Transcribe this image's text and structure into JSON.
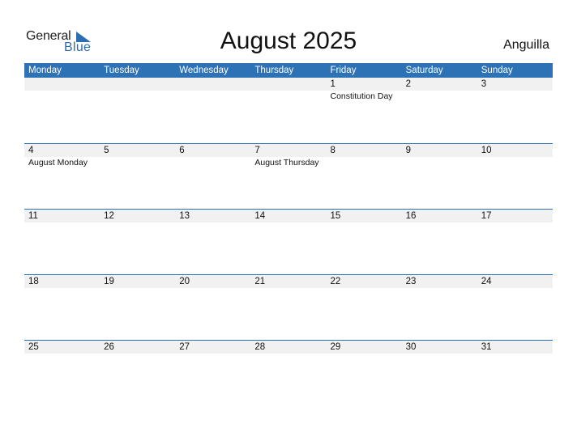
{
  "logo": {
    "line1": "General",
    "line2": "Blue"
  },
  "title": "August 2025",
  "country": "Anguilla",
  "colors": {
    "accent": "#2e72b6",
    "band": "#f1f1f1"
  },
  "weekdays": [
    "Monday",
    "Tuesday",
    "Wednesday",
    "Thursday",
    "Friday",
    "Saturday",
    "Sunday"
  ],
  "weeks": [
    {
      "days": [
        {
          "num": "",
          "holiday": ""
        },
        {
          "num": "",
          "holiday": ""
        },
        {
          "num": "",
          "holiday": ""
        },
        {
          "num": "",
          "holiday": ""
        },
        {
          "num": "1",
          "holiday": "Constitution Day"
        },
        {
          "num": "2",
          "holiday": ""
        },
        {
          "num": "3",
          "holiday": ""
        }
      ]
    },
    {
      "days": [
        {
          "num": "4",
          "holiday": "August Monday"
        },
        {
          "num": "5",
          "holiday": ""
        },
        {
          "num": "6",
          "holiday": ""
        },
        {
          "num": "7",
          "holiday": "August Thursday"
        },
        {
          "num": "8",
          "holiday": ""
        },
        {
          "num": "9",
          "holiday": ""
        },
        {
          "num": "10",
          "holiday": ""
        }
      ]
    },
    {
      "days": [
        {
          "num": "11",
          "holiday": ""
        },
        {
          "num": "12",
          "holiday": ""
        },
        {
          "num": "13",
          "holiday": ""
        },
        {
          "num": "14",
          "holiday": ""
        },
        {
          "num": "15",
          "holiday": ""
        },
        {
          "num": "16",
          "holiday": ""
        },
        {
          "num": "17",
          "holiday": ""
        }
      ]
    },
    {
      "days": [
        {
          "num": "18",
          "holiday": ""
        },
        {
          "num": "19",
          "holiday": ""
        },
        {
          "num": "20",
          "holiday": ""
        },
        {
          "num": "21",
          "holiday": ""
        },
        {
          "num": "22",
          "holiday": ""
        },
        {
          "num": "23",
          "holiday": ""
        },
        {
          "num": "24",
          "holiday": ""
        }
      ]
    },
    {
      "days": [
        {
          "num": "25",
          "holiday": ""
        },
        {
          "num": "26",
          "holiday": ""
        },
        {
          "num": "27",
          "holiday": ""
        },
        {
          "num": "28",
          "holiday": ""
        },
        {
          "num": "29",
          "holiday": ""
        },
        {
          "num": "30",
          "holiday": ""
        },
        {
          "num": "31",
          "holiday": ""
        }
      ]
    }
  ]
}
